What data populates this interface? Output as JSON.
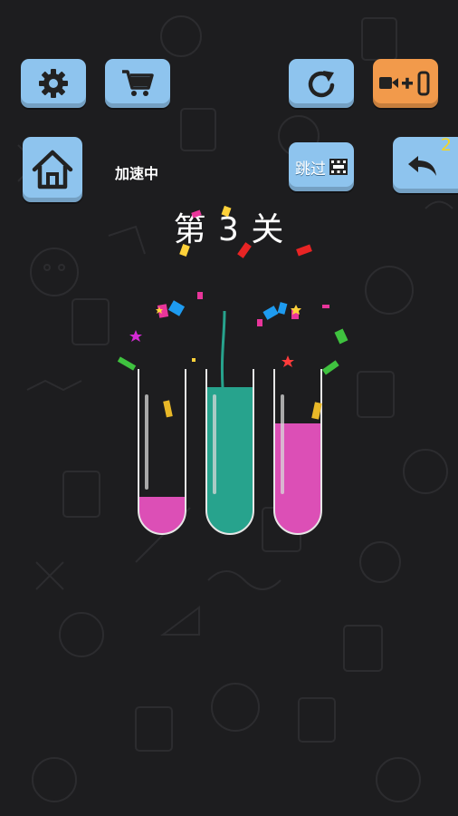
{
  "toolbar": {
    "settings_icon": "gear-icon",
    "shop_icon": "cart-icon",
    "restart_icon": "restart-icon",
    "add_tube_icon": "video-plus-tube-icon",
    "add_tube_plus": "+",
    "home_icon": "home-icon",
    "speed_status": "加速中",
    "skip_label": "跳过",
    "skip_icon": "film-icon",
    "undo_icon": "undo-icon",
    "undo_count": "2"
  },
  "level": {
    "title": "第 3 关"
  },
  "tubes": [
    {
      "color": "#dc4fb6",
      "fill_fraction": 0.22
    },
    {
      "color": "#27a38d",
      "fill_fraction": 0.92
    },
    {
      "color": "#dc4fb6",
      "fill_fraction": 0.7
    }
  ],
  "colors": {
    "button_blue": "#8ec4ee",
    "button_orange": "#f29a4b",
    "pink_liquid": "#dc4fb6",
    "teal_liquid": "#27a38d",
    "undo_count": "#f5d623"
  }
}
